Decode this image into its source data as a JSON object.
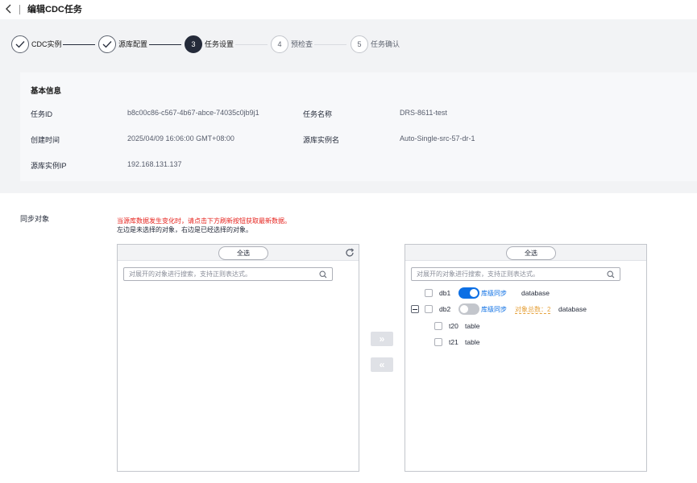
{
  "header": {
    "back_icon": "back-arrow-icon",
    "title": "编辑CDC任务"
  },
  "steps": [
    {
      "number": "",
      "label": "CDC实例",
      "state": "done"
    },
    {
      "number": "",
      "label": "源库配置",
      "state": "done"
    },
    {
      "number": "3",
      "label": "任务设置",
      "state": "active"
    },
    {
      "number": "4",
      "label": "预检查",
      "state": "pending"
    },
    {
      "number": "5",
      "label": "任务确认",
      "state": "pending"
    }
  ],
  "basic_info": {
    "title": "基本信息",
    "task_id_label": "任务ID",
    "task_id_value": "b8c00c86-c567-4b67-abce-74035c0jb9j1",
    "task_name_label": "任务名称",
    "task_name_value": "DRS-8611-test",
    "create_time_label": "创建时间",
    "create_time_value": "2025/04/09 16:06:00 GMT+08:00",
    "source_instance_name_label": "源库实例名",
    "source_instance_name_value": "Auto-Single-src-57-dr-1",
    "source_ip_label": "源库实例IP",
    "source_ip_value": "192.168.131.137"
  },
  "sync": {
    "label": "同步对象",
    "warning": "当源库数据发生变化时，请点击下方刷新按钮获取最新数据。",
    "hint": "左边是未选择的对象，右边是已经选择的对象。",
    "left_panel": {
      "select_all_label": "全选",
      "search_placeholder": "对展开的对象进行搜索，支持正则表达式。"
    },
    "right_panel": {
      "select_all_label": "全选",
      "search_placeholder": "对展开的对象进行搜索，支持正则表达式。",
      "rows": [
        {
          "name": "db1",
          "toggle_on": true,
          "toggle_label": "库级同步",
          "count_label": "",
          "type": "database"
        },
        {
          "name": "db2",
          "toggle_on": false,
          "toggle_label": "库级同步",
          "count_label": "对象总数：2",
          "type": "database"
        },
        {
          "name": "t20",
          "type": "table"
        },
        {
          "name": "t21",
          "type": "table"
        }
      ]
    },
    "move_right_label": "»",
    "move_left_label": "«"
  },
  "colors": {
    "primary": "#0c6fe4",
    "warning": "#e6231e",
    "count": "#e6a23c",
    "step_active": "#252b3a"
  }
}
